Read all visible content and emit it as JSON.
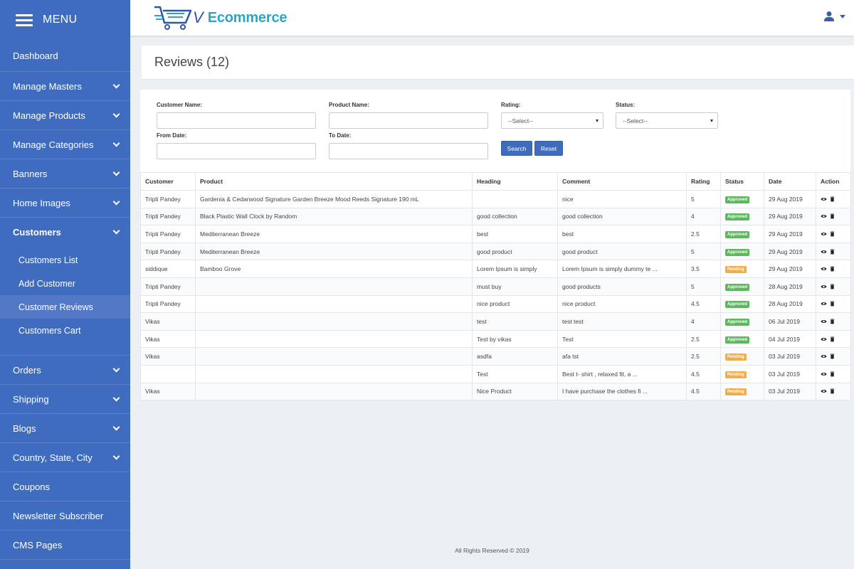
{
  "sidebar": {
    "menu_title": "MENU",
    "items_top": [
      {
        "label": "Dashboard",
        "has_chevron": false
      },
      {
        "label": "Manage Masters",
        "has_chevron": true
      },
      {
        "label": "Manage Products",
        "has_chevron": true
      },
      {
        "label": "Manage Categories",
        "has_chevron": true
      },
      {
        "label": "Banners",
        "has_chevron": true
      },
      {
        "label": "Home Images",
        "has_chevron": true
      }
    ],
    "active_item": {
      "label": "Customers"
    },
    "submenu": [
      {
        "label": "Customers List",
        "active": false
      },
      {
        "label": "Add Customer",
        "active": false
      },
      {
        "label": "Customer Reviews",
        "active": true
      },
      {
        "label": "Customers Cart",
        "active": false
      }
    ],
    "items_bottom": [
      {
        "label": "Orders",
        "has_chevron": true
      },
      {
        "label": "Shipping",
        "has_chevron": true
      },
      {
        "label": "Blogs",
        "has_chevron": true
      },
      {
        "label": "Country, State, City",
        "has_chevron": true
      },
      {
        "label": "Coupons",
        "has_chevron": false
      },
      {
        "label": "Newsletter Subscriber",
        "has_chevron": false
      },
      {
        "label": "CMS Pages",
        "has_chevron": false
      }
    ]
  },
  "header": {
    "logo_mark": "V",
    "logo_text": "Ecommerce",
    "user_icon": "user-icon"
  },
  "page": {
    "title": "Reviews (12)"
  },
  "filters": {
    "customer_name_label": "Customer Name:",
    "product_name_label": "Product Name:",
    "rating_label": "Rating:",
    "status_label": "Status:",
    "from_date_label": "From Date:",
    "to_date_label": "To Date:",
    "rating_selected": "--Select--",
    "status_selected": "--Select--",
    "customer_name_value": "",
    "product_name_value": "",
    "from_date_value": "",
    "to_date_value": "",
    "search_label": "Search",
    "reset_label": "Reset"
  },
  "table": {
    "columns": [
      "Customer",
      "Product",
      "Heading",
      "Comment",
      "Rating",
      "Status",
      "Date",
      "Action"
    ],
    "rows": [
      {
        "customer": "Tripti Pandey",
        "product": "Gardenia & Cedarwood Signature Garden Breeze Mood Reeds Signature 190 mL",
        "heading": "",
        "comment": "nice",
        "rating": "5",
        "status": "Approved",
        "date": "29 Aug 2019"
      },
      {
        "customer": "Tripti Pandey",
        "product": "Black Plastic Wall Clock by Random",
        "heading": "good collection",
        "comment": "good collection",
        "rating": "4",
        "status": "Approved",
        "date": "29 Aug 2019"
      },
      {
        "customer": "Tripti Pandey",
        "product": "Mediterranean Breeze",
        "heading": "best",
        "comment": "best",
        "rating": "2.5",
        "status": "Approved",
        "date": "29 Aug 2019"
      },
      {
        "customer": "Tripti Pandey",
        "product": "Mediterranean Breeze",
        "heading": "good product",
        "comment": "good product",
        "rating": "5",
        "status": "Approved",
        "date": "29 Aug 2019"
      },
      {
        "customer": "siddique",
        "product": "Bamboo Grove",
        "heading": "Lorem Ipsum is simply",
        "comment": "Lorem Ipsum is simply dummy te ...",
        "rating": "3.5",
        "status": "Pending",
        "date": "29 Aug 2019"
      },
      {
        "customer": "Tripti Pandey",
        "product": "",
        "heading": "must buy",
        "comment": "good products",
        "rating": "5",
        "status": "Approved",
        "date": "28 Aug 2019"
      },
      {
        "customer": "Tripti Pandey",
        "product": "",
        "heading": "nice product",
        "comment": "nice product",
        "rating": "4.5",
        "status": "Approved",
        "date": "28 Aug 2019"
      },
      {
        "customer": "Vikas",
        "product": "",
        "heading": "test",
        "comment": "test test",
        "rating": "4",
        "status": "Approved",
        "date": "06 Jul 2019"
      },
      {
        "customer": "Vikas",
        "product": "",
        "heading": "Test by vikas",
        "comment": "Test",
        "rating": "2.5",
        "status": "Approved",
        "date": "04 Jul 2019"
      },
      {
        "customer": "Vikas",
        "product": "",
        "heading": "asdfa",
        "comment": "afa tst",
        "rating": "2.5",
        "status": "Pending",
        "date": "03 Jul 2019"
      },
      {
        "customer": "",
        "product": "",
        "heading": "Test",
        "comment": "Best t- shirt , relaxed fit, a ...",
        "rating": "4.5",
        "status": "Pending",
        "date": "03 Jul 2019"
      },
      {
        "customer": "Vikas",
        "product": "",
        "heading": "Nice Product",
        "comment": "I have purchase the clothes fi ...",
        "rating": "4.5",
        "status": "Pending",
        "date": "03 Jul 2019"
      }
    ],
    "action_icons": [
      "eye-icon",
      "trash-icon"
    ]
  },
  "colors": {
    "sidebar_bg": "#3f6cbf",
    "submenu_active_bg": "#5278c6",
    "approved": "#5cb85c",
    "pending": "#f0ad4e",
    "brand_text": "#2aa6c9"
  },
  "footer": {
    "text": "All Rights Reserved © 2019"
  }
}
